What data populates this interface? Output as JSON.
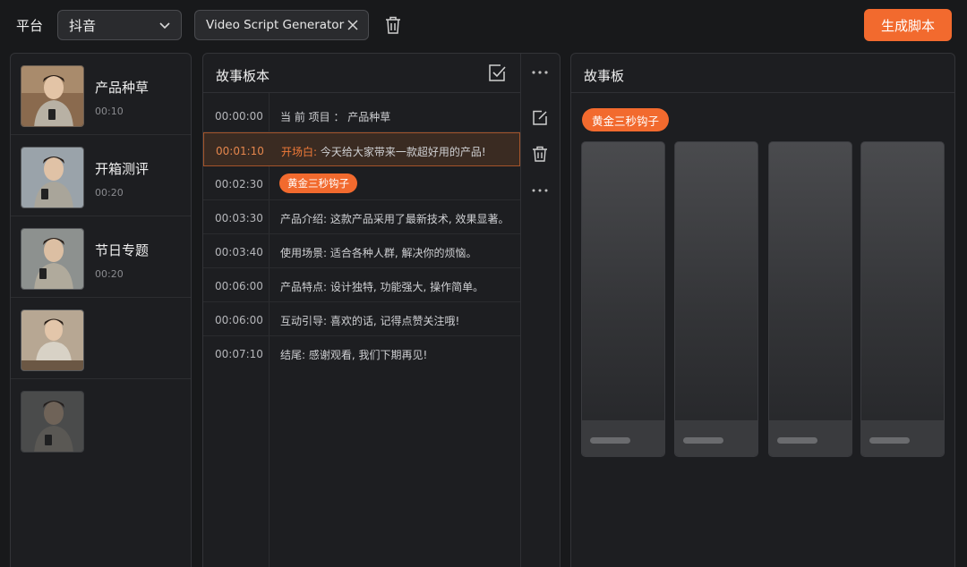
{
  "header": {
    "platform_label": "平台",
    "platform_value": "抖音",
    "project_tab_label": "Video Sсript Generator",
    "generate_label": "生成脚本"
  },
  "projects": [
    {
      "title": "产品种草",
      "time": "00:10"
    },
    {
      "title": "开箱测评",
      "time": "00:20"
    },
    {
      "title": "节日专题",
      "time": "00:20"
    },
    {
      "title": "",
      "time": ""
    },
    {
      "title": "",
      "time": ""
    }
  ],
  "script": {
    "title": "故事板本",
    "rows": [
      {
        "time": "00:00:00",
        "text": "当 前 项目 ： 产品种草"
      },
      {
        "time": "00:01:10",
        "lead": "开场白:",
        "text": " 今天给大家带来一款超好用的产品!"
      },
      {
        "time": "00:02:30",
        "tag": "黄金三秒钩子"
      },
      {
        "time": "00:03:30",
        "text": "产品介绍: 这款产品采用了最新技术, 效果显著。"
      },
      {
        "time": "00:03:40",
        "text": "使用场景: 适合各种人群, 解决你的烦恼。"
      },
      {
        "time": "00:06:00",
        "text": "产品特点: 设计独特, 功能强大, 操作简单。"
      },
      {
        "time": "00:06:00",
        "text": "互动引导: 喜欢的话, 记得点赞关注哦!"
      },
      {
        "time": "00:07:10",
        "text": "结尾: 感谢观看, 我们下期再见!"
      }
    ]
  },
  "board": {
    "title": "故事板",
    "tag": "黄金三秒钩子",
    "frame_count": 4
  },
  "icons": {
    "platform_chevron": "chevron-down-icon",
    "tab_close": "close-icon",
    "top_delete": "trash-icon",
    "script_confirm": "check-square-icon",
    "script_more": "more-icon",
    "row_edit": "edit-icon",
    "row_delete": "trash-icon",
    "row_more": "more-icon"
  },
  "colors": {
    "accent": "#f26a2e",
    "background": "#18191b",
    "panel": "#1d1e21",
    "active_row": "#3a2b22"
  }
}
